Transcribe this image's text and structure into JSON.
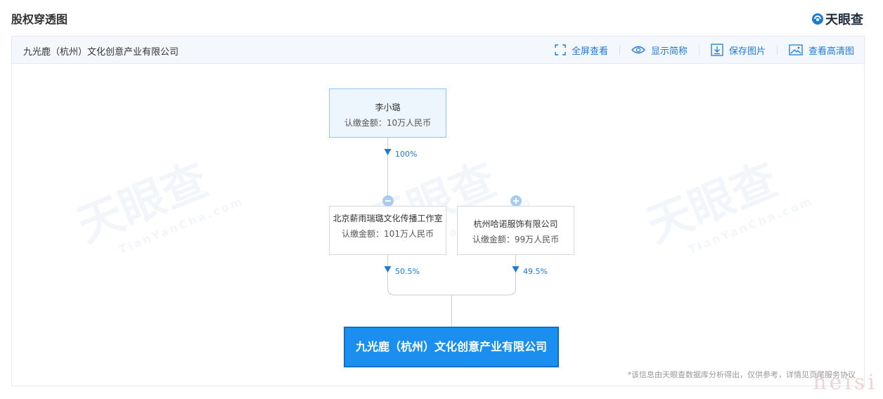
{
  "header": {
    "title": "股权穿透图",
    "brand": "天眼查"
  },
  "panel": {
    "company_name": "九光鹿（杭州）文化创意产业有限公司",
    "toolbar": [
      {
        "label": "全屏查看",
        "icon": "fullscreen-icon"
      },
      {
        "label": "显示简称",
        "icon": "eye-icon"
      },
      {
        "label": "保存图片",
        "icon": "download-icon"
      },
      {
        "label": "查看高清图",
        "icon": "image-icon"
      }
    ]
  },
  "diagram": {
    "top_node": {
      "name": "李小璐",
      "amount": "认缴金额：10万人民币"
    },
    "top_edge_pct": "100%",
    "mid_nodes": [
      {
        "name": "北京薪雨瑞璐文化传播工作室",
        "amount": "认缴金额：101万人民币",
        "pct": "50.5%",
        "toggle": "collapse"
      },
      {
        "name": "杭州哈诺服饰有限公司",
        "amount": "认缴金额：99万人民币",
        "pct": "49.5%",
        "toggle": "expand"
      }
    ],
    "target_node": {
      "name": "九光鹿（杭州）文化创意产业有限公司"
    }
  },
  "watermark": {
    "brand": "天眼查",
    "domain": "TianYanCha.com"
  },
  "disclaimer": "*该信息由天眼查数据库分析得出，仅供参考，详情见页尾服务协议",
  "corner_watermark": "heisi",
  "colors": {
    "accent": "#1c7ad8",
    "target_fill": "#1b8ff0",
    "top_node_fill": "#eef6fd"
  }
}
